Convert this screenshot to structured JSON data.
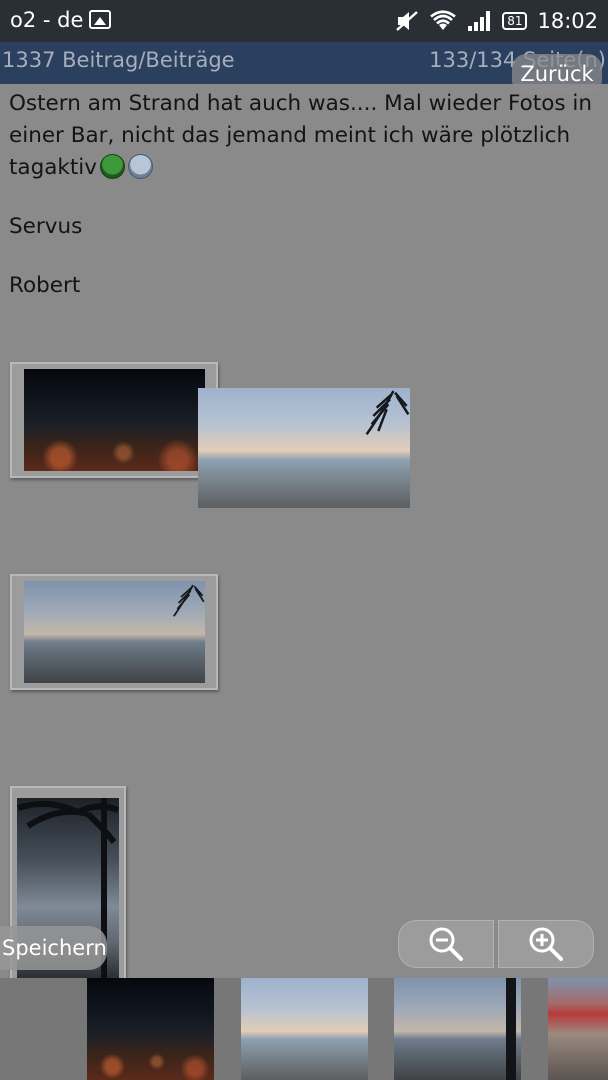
{
  "status_bar": {
    "carrier": "o2 - de",
    "battery": "81",
    "time": "18:02"
  },
  "header": {
    "post_count": "1337 Beitrag/Beiträge",
    "page_info": "133/134 Seite(n)",
    "back_label": "Zurück"
  },
  "post": {
    "text": "Ostern am Strand hat auch was.... Mal wieder Fotos in einer Bar, nicht das jemand meint ich wäre plötzlich tagaktiv",
    "greeting": "Servus",
    "signature": "Robert"
  },
  "actions": {
    "save_label": "Speichern"
  },
  "icons": {
    "status": [
      "image-icon",
      "mute-icon",
      "wifi-icon",
      "signal-icon",
      "battery-icon"
    ],
    "zoom": [
      "zoom-out-icon",
      "zoom-in-icon"
    ]
  }
}
